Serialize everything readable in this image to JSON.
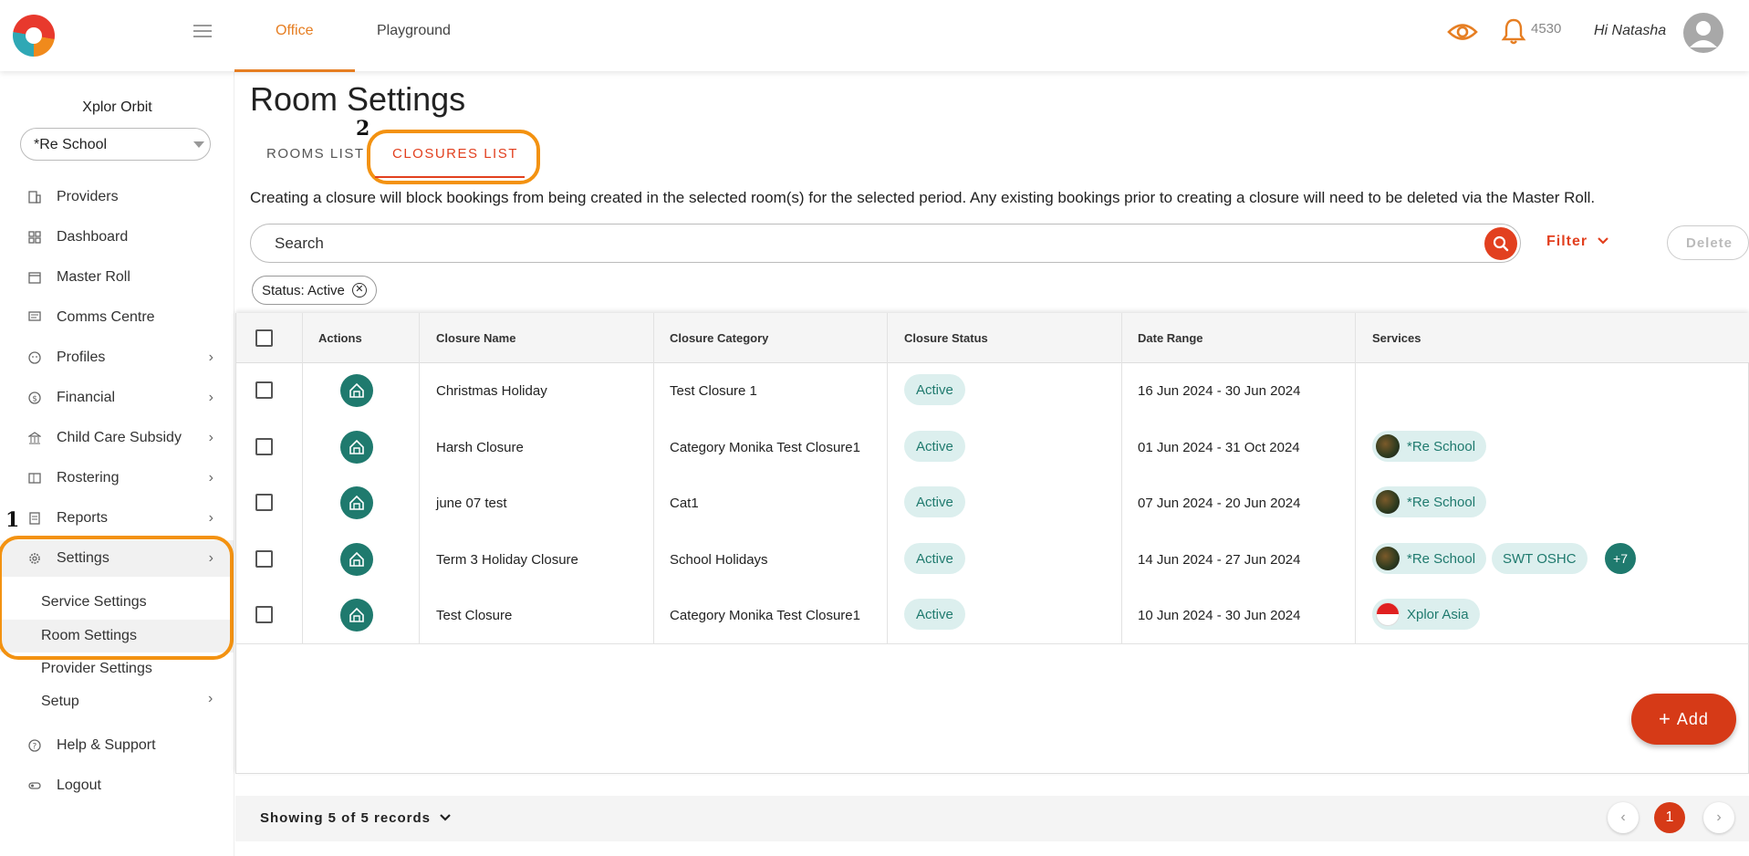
{
  "header": {
    "tabs": [
      {
        "label": "Office"
      },
      {
        "label": "Playground"
      }
    ],
    "notification_count": "4530",
    "greeting": "Hi Natasha"
  },
  "sidebar": {
    "org_name": "Xplor Orbit",
    "org_select": "*Re School",
    "items": [
      {
        "label": "Providers",
        "icon": "building-icon"
      },
      {
        "label": "Dashboard",
        "icon": "grid-icon"
      },
      {
        "label": "Master Roll",
        "icon": "calendar-icon"
      },
      {
        "label": "Comms Centre",
        "icon": "message-icon"
      },
      {
        "label": "Profiles",
        "icon": "profile-icon"
      },
      {
        "label": "Financial",
        "icon": "dollar-icon"
      },
      {
        "label": "Child Care Subsidy",
        "icon": "bank-icon"
      },
      {
        "label": "Rostering",
        "icon": "roster-icon"
      },
      {
        "label": "Reports",
        "icon": "report-icon"
      },
      {
        "label": "Settings",
        "icon": "gear-icon"
      }
    ],
    "settings_sub": [
      {
        "label": "Service Settings"
      },
      {
        "label": "Room Settings"
      }
    ],
    "more_items": [
      {
        "label": "Provider Settings"
      },
      {
        "label": "Setup"
      }
    ],
    "bottom_items": [
      {
        "label": "Help & Support",
        "icon": "help-icon"
      },
      {
        "label": "Logout",
        "icon": "logout-icon"
      }
    ]
  },
  "annotations": {
    "one": "1",
    "two": "2"
  },
  "main": {
    "title": "Room Settings",
    "tabs": [
      {
        "label": "ROOMS LIST"
      },
      {
        "label": "CLOSURES LIST"
      }
    ],
    "info": "Creating a closure will block bookings from being created in the selected room(s) for the selected period. Any existing bookings prior to creating a closure will need to be deleted via the Master Roll.",
    "search_placeholder": "Search",
    "filter_label": "Filter",
    "delete_label": "Delete",
    "chip_label": "Status: Active",
    "add_label": "Add"
  },
  "table": {
    "headers": [
      "Actions",
      "Closure Name",
      "Closure Category",
      "Closure Status",
      "Date Range",
      "Services"
    ],
    "rows": [
      {
        "name": "Christmas Holiday",
        "category": "Test Closure 1",
        "status": "Active",
        "range": "16 Jun 2024 - 30 Jun 2024",
        "services": []
      },
      {
        "name": "Harsh Closure",
        "category": "Category Monika Test Closure1",
        "status": "Active",
        "range": "01 Jun 2024 - 31 Oct 2024",
        "services": [
          "*Re School"
        ]
      },
      {
        "name": "june 07 test",
        "category": "Cat1",
        "status": "Active",
        "range": "07 Jun 2024 - 20 Jun 2024",
        "services": [
          "*Re School"
        ]
      },
      {
        "name": "Term 3 Holiday Closure",
        "category": "School Holidays",
        "status": "Active",
        "range": "14 Jun 2024 - 27 Jun 2024",
        "services": [
          "*Re School",
          "SWT OSHC"
        ],
        "more": "+7"
      },
      {
        "name": "Test Closure",
        "category": "Category Monika Test Closure1",
        "status": "Active",
        "range": "10 Jun 2024 - 30 Jun 2024",
        "services": [
          "Xplor Asia"
        ]
      }
    ]
  },
  "footer": {
    "records": "Showing 5 of 5 records",
    "page": "1"
  },
  "colors": {
    "accent": "#e2401f",
    "teal": "#1f7a6e",
    "highlight": "#f39211",
    "orange_tab": "#e67e22"
  }
}
